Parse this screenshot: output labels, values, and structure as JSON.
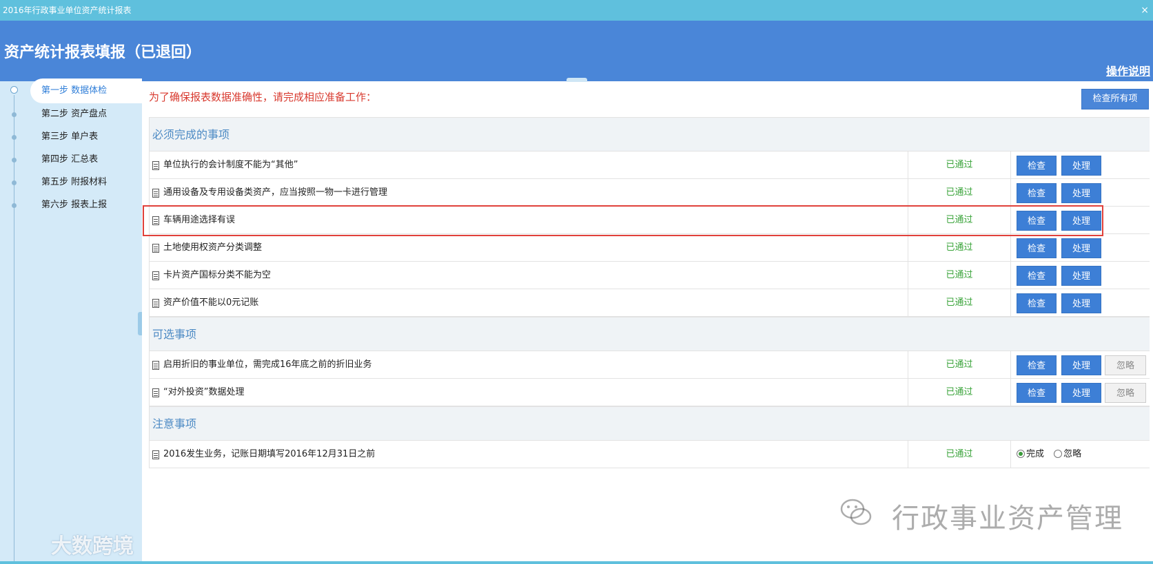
{
  "window": {
    "title": "2016年行政事业单位资产统计报表",
    "close": "×"
  },
  "header": {
    "title": "资产统计报表填报（已退回）",
    "help": "操作说明"
  },
  "sidebar": {
    "steps": [
      {
        "label": "第一步 数据体检"
      },
      {
        "label": "第二步 资产盘点"
      },
      {
        "label": "第三步 单户表"
      },
      {
        "label": "第四步 汇总表"
      },
      {
        "label": "第五步 附报材料"
      },
      {
        "label": "第六步 报表上报"
      }
    ]
  },
  "main": {
    "notice": "为了确保报表数据准确性，请完成相应准备工作：",
    "check_all": "检查所有项",
    "labels": {
      "check": "检查",
      "handle": "处理",
      "ignore": "忽略",
      "done": "完成",
      "skip": "忽略"
    },
    "sections": [
      {
        "title": "必须完成的事项",
        "rows": [
          {
            "label": "单位执行的会计制度不能为“其他”",
            "status": "已通过"
          },
          {
            "label": "通用设备及专用设备类资产，应当按照一物一卡进行管理",
            "status": "已通过"
          },
          {
            "label": "车辆用途选择有误",
            "status": "已通过"
          },
          {
            "label": "土地使用权资产分类调整",
            "status": "已通过"
          },
          {
            "label": "卡片资产国标分类不能为空",
            "status": "已通过"
          },
          {
            "label": "资产价值不能以0元记账",
            "status": "已通过"
          }
        ]
      },
      {
        "title": "可选事项",
        "rows": [
          {
            "label": "启用折旧的事业单位，需完成16年底之前的折旧业务",
            "status": "已通过"
          },
          {
            "label": "“对外投资”数据处理",
            "status": "已通过"
          }
        ]
      },
      {
        "title": "注意事项",
        "rows": [
          {
            "label": "2016发生业务，记账日期填写2016年12月31日之前",
            "status": "已通过"
          }
        ]
      }
    ]
  },
  "watermarks": {
    "wechat": "行政事业资产管理",
    "brand": "大数跨境"
  },
  "colors": {
    "header": "#4a86d8",
    "titlebar": "#5fc0dd",
    "sidebar": "#d4eaf8",
    "button": "#3d7fd6",
    "pass": "#39a339",
    "notice": "#d83a2f",
    "highlight": "#e0403a"
  }
}
